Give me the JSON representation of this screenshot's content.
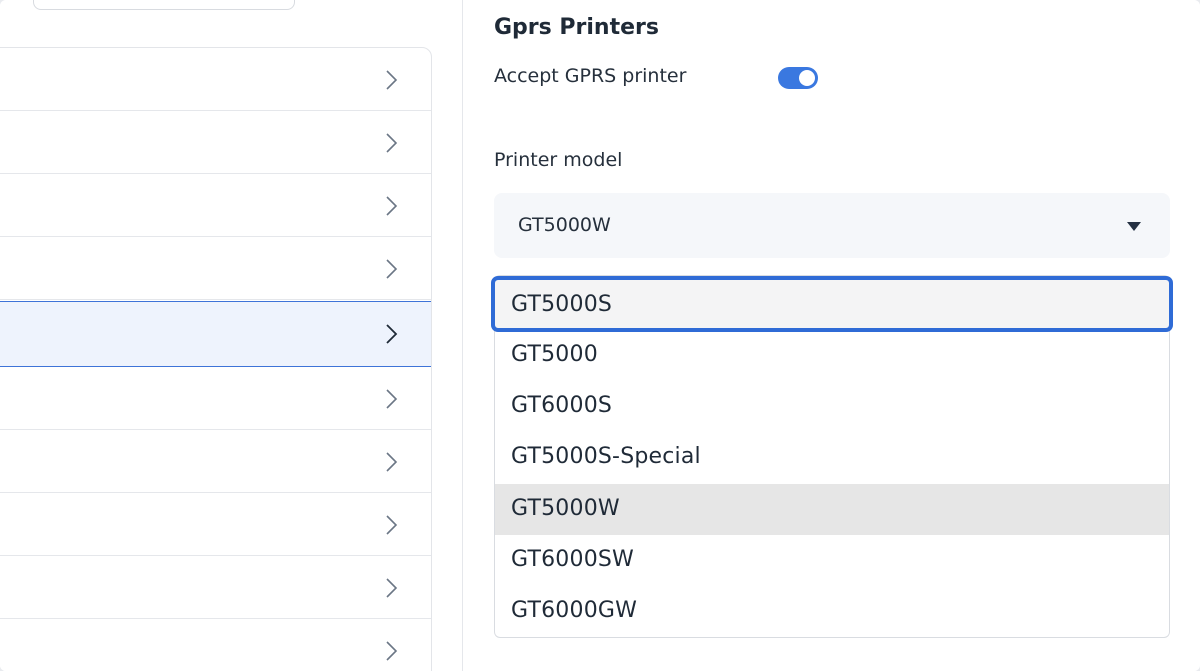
{
  "nav": {
    "item_count": 10,
    "active_index": 4
  },
  "printers": {
    "title": "Gprs Printers",
    "accept_label": "Accept GPRS printer",
    "accept_enabled": true,
    "model_label": "Printer model",
    "model_value": "GT5000W",
    "options": [
      {
        "label": "GT5000S",
        "state": "focused"
      },
      {
        "label": "GT5000",
        "state": ""
      },
      {
        "label": "GT6000S",
        "state": ""
      },
      {
        "label": "GT5000S-Special",
        "state": ""
      },
      {
        "label": "GT5000W",
        "state": "selected"
      },
      {
        "label": "GT6000SW",
        "state": ""
      },
      {
        "label": "GT6000GW",
        "state": ""
      }
    ]
  },
  "icons": {
    "nav_chevron": "chevron-right-icon",
    "select_caret": "caret-down-icon"
  },
  "colors": {
    "accent": "#3a78e0",
    "focus_ring": "#2f6bd6",
    "active_row_bg": "#eef3fd",
    "selected_option_bg": "#e6e6e6"
  }
}
